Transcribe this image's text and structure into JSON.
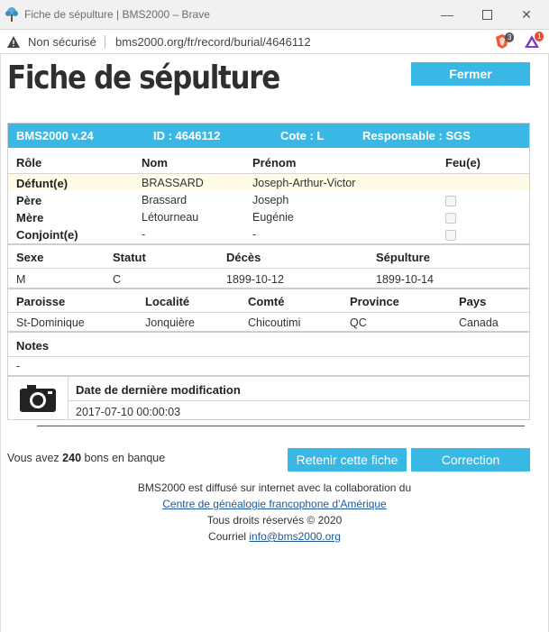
{
  "window": {
    "title": "Fiche de sépulture | BMS2000 – Brave",
    "url": "bms2000.org/fr/record/burial/4646112",
    "security_label": "Non sécurisé",
    "brave_badge": "3",
    "rewards_badge": "1"
  },
  "page": {
    "title": "Fiche de sépulture",
    "close_button": "Fermer"
  },
  "record": {
    "header": {
      "version": "BMS2000 v.24",
      "id": "ID : 4646112",
      "cote": "Cote : L",
      "responsable": "Responsable : SGS"
    },
    "people_headers": [
      "Rôle",
      "Nom",
      "Prénom",
      "Feu(e)"
    ],
    "people": [
      {
        "role": "Défunt(e)",
        "nom": "BRASSARD",
        "prenom": "Joseph-Arthur-Victor",
        "feu": null
      },
      {
        "role": "Père",
        "nom": "Brassard",
        "prenom": "Joseph",
        "feu": false
      },
      {
        "role": "Mère",
        "nom": "Létourneau",
        "prenom": "Eugénie",
        "feu": false
      },
      {
        "role": "Conjoint(e)",
        "nom": "-",
        "prenom": "-",
        "feu": false
      }
    ],
    "vital_headers": [
      "Sexe",
      "Statut",
      "Décès",
      "Sépulture"
    ],
    "vital": {
      "sexe": "M",
      "statut": "C",
      "deces": "1899-10-12",
      "sepulture": "1899-10-14"
    },
    "place_headers": [
      "Paroisse",
      "Localité",
      "Comté",
      "Province",
      "Pays"
    ],
    "place": {
      "paroisse": "St-Dominique",
      "localite": "Jonquière",
      "comte": "Chicoutimi",
      "province": "QC",
      "pays": "Canada"
    },
    "notes_header": "Notes",
    "notes": "-",
    "modified_header": "Date de dernière modification",
    "modified": "2017-07-10 00:00:03"
  },
  "actions": {
    "bank_prefix": "Vous avez",
    "bank_amount": "240",
    "bank_suffix": "bons en banque",
    "retain_button": "Retenir cette fiche",
    "correction_button": "Correction"
  },
  "footer": {
    "line1": "BMS2000 est diffusé sur internet avec la collaboration du",
    "link": "Centre de généalogie francophone d'Amérique",
    "rights": "Tous droits réservés © 2020",
    "courriel_label": "Courriel",
    "email": "info@bms2000.org"
  },
  "colors": {
    "accent": "#3ab8e5",
    "highlight_row": "#fffbe7",
    "link": "#1a5a9c"
  }
}
